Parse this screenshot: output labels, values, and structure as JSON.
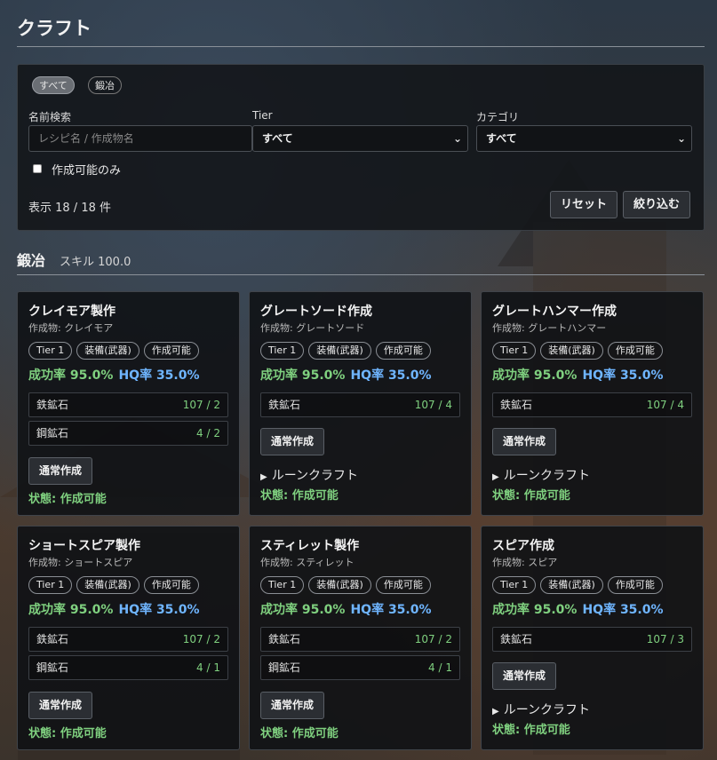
{
  "page": {
    "title": "クラフト"
  },
  "filters": {
    "category_tabs": [
      {
        "label": "すべて",
        "active": true
      },
      {
        "label": "鍛冶",
        "active": false
      }
    ],
    "name_label": "名前検索",
    "name_placeholder": "レシピ名 / 作成物名",
    "tier_label": "Tier",
    "tier_value": "すべて",
    "category_label": "カテゴリ",
    "category_value": "すべて",
    "craftable_only_label": "作成可能のみ",
    "craftable_only_checked": false,
    "count_text": "表示 18 / 18 件",
    "reset_label": "リセット",
    "apply_label": "絞り込む"
  },
  "section": {
    "title": "鍛冶",
    "skill": "スキル 100.0"
  },
  "recipes": [
    {
      "title": "クレイモア製作",
      "product": "作成物: クレイモア",
      "badges": [
        "Tier 1",
        "装備(武器)",
        "作成可能"
      ],
      "success": "成功率 95.0%",
      "hq": "HQ率 35.0%",
      "materials": [
        {
          "name": "鉄鉱石",
          "qty": "107 / 2"
        },
        {
          "name": "鋼鉱石",
          "qty": "4 / 2"
        }
      ],
      "craft_label": "通常作成",
      "rune_label": "",
      "status": "状態: 作成可能"
    },
    {
      "title": "グレートソード作成",
      "product": "作成物: グレートソード",
      "badges": [
        "Tier 1",
        "装備(武器)",
        "作成可能"
      ],
      "success": "成功率 95.0%",
      "hq": "HQ率 35.0%",
      "materials": [
        {
          "name": "鉄鉱石",
          "qty": "107 / 4"
        }
      ],
      "craft_label": "通常作成",
      "rune_label": "ルーンクラフト",
      "status": "状態: 作成可能"
    },
    {
      "title": "グレートハンマー作成",
      "product": "作成物: グレートハンマー",
      "badges": [
        "Tier 1",
        "装備(武器)",
        "作成可能"
      ],
      "success": "成功率 95.0%",
      "hq": "HQ率 35.0%",
      "materials": [
        {
          "name": "鉄鉱石",
          "qty": "107 / 4"
        }
      ],
      "craft_label": "通常作成",
      "rune_label": "ルーンクラフト",
      "status": "状態: 作成可能"
    },
    {
      "title": "ショートスピア製作",
      "product": "作成物: ショートスピア",
      "badges": [
        "Tier 1",
        "装備(武器)",
        "作成可能"
      ],
      "success": "成功率 95.0%",
      "hq": "HQ率 35.0%",
      "materials": [
        {
          "name": "鉄鉱石",
          "qty": "107 / 2"
        },
        {
          "name": "鋼鉱石",
          "qty": "4 / 1"
        }
      ],
      "craft_label": "通常作成",
      "rune_label": "",
      "status": "状態: 作成可能"
    },
    {
      "title": "スティレット製作",
      "product": "作成物: スティレット",
      "badges": [
        "Tier 1",
        "装備(武器)",
        "作成可能"
      ],
      "success": "成功率 95.0%",
      "hq": "HQ率 35.0%",
      "materials": [
        {
          "name": "鉄鉱石",
          "qty": "107 / 2"
        },
        {
          "name": "鋼鉱石",
          "qty": "4 / 1"
        }
      ],
      "craft_label": "通常作成",
      "rune_label": "",
      "status": "状態: 作成可能"
    },
    {
      "title": "スピア作成",
      "product": "作成物: スピア",
      "badges": [
        "Tier 1",
        "装備(武器)",
        "作成可能"
      ],
      "success": "成功率 95.0%",
      "hq": "HQ率 35.0%",
      "materials": [
        {
          "name": "鉄鉱石",
          "qty": "107 / 3"
        }
      ],
      "craft_label": "通常作成",
      "rune_label": "ルーンクラフト",
      "status": "状態: 作成可能"
    }
  ],
  "colors": {
    "success": "#7fd07f",
    "hq": "#6fb5ff",
    "panel": "#121418"
  }
}
